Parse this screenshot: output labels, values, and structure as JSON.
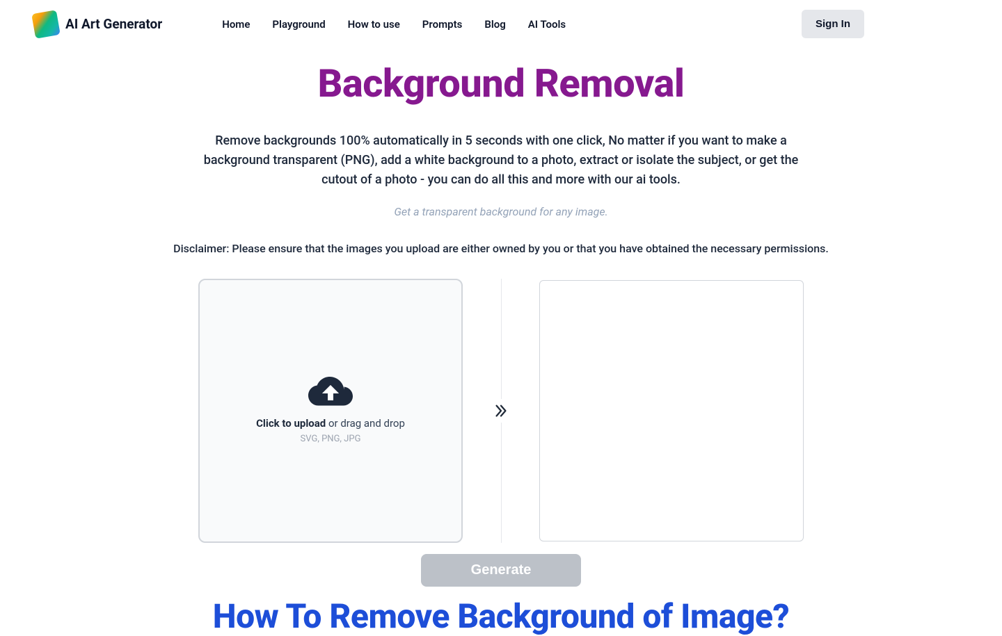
{
  "brand": {
    "name": "AI Art Generator"
  },
  "nav": {
    "home": "Home",
    "playground": "Playground",
    "howtouse": "How to use",
    "prompts": "Prompts",
    "blog": "Blog",
    "aitools": "AI Tools"
  },
  "signin_label": "Sign In",
  "page": {
    "title": "Background Removal",
    "description": "Remove backgrounds 100% automatically in 5 seconds with one click, No matter if you want to make a background transparent (PNG), add a white background to a photo, extract or isolate the subject, or get the cutout of a photo - you can do all this and more with our ai tools.",
    "tagline": "Get a transparent background for any image.",
    "disclaimer": "Disclaimer: Please ensure that the images you upload are either owned by you or that you have obtained the necessary permissions."
  },
  "uploader": {
    "click_label": "Click to upload",
    "drag_label": " or drag and drop",
    "formats": "SVG, PNG, JPG"
  },
  "generate_label": "Generate",
  "howto_title": "How To Remove Background of Image?"
}
